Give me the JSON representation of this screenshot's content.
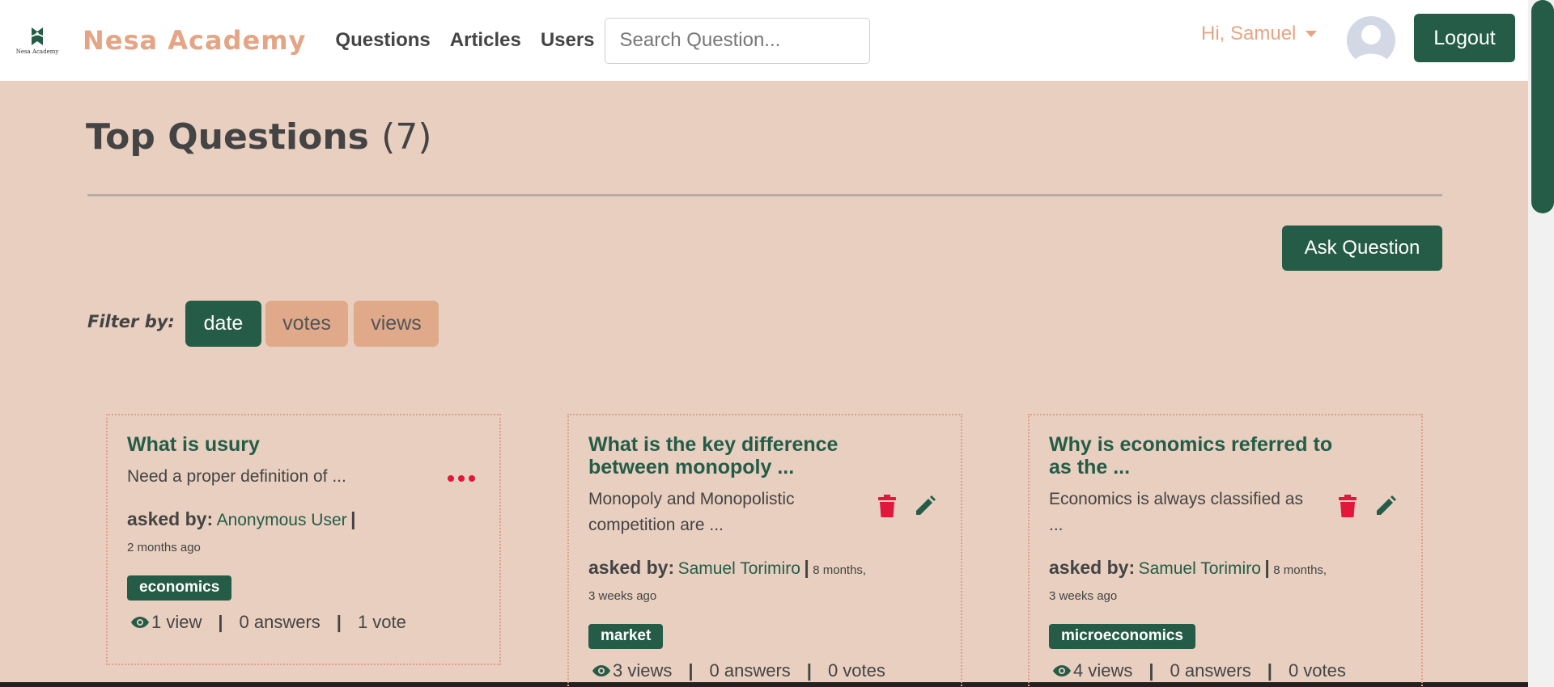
{
  "navbar": {
    "logo_text": "Nesa Academy",
    "brand": "Nesa Academy",
    "links": [
      "Questions",
      "Articles",
      "Users"
    ],
    "search_placeholder": "Search Question...",
    "greeting": "Hi, Samuel",
    "logout_label": "Logout"
  },
  "page": {
    "title": "Top Questions",
    "count": "(7)",
    "ask_label": "Ask Question",
    "filter_label": "Filter by:",
    "filters": [
      "date",
      "votes",
      "views"
    ],
    "active_filter": "date"
  },
  "questions": [
    {
      "title": "What is usury",
      "excerpt": "Need a proper definition of ...",
      "asked_by_label": "asked by:",
      "author": "Anonymous User",
      "time": "2 months ago",
      "tag": "economics",
      "views": "1 view",
      "answers": "0 answers",
      "votes": "1 vote"
    },
    {
      "title": "What is the key difference between monopoly ...",
      "excerpt": "Monopoly and Monopolistic competition are ...",
      "asked_by_label": "asked by:",
      "author": "Samuel Torimiro",
      "time_part1": "8 months,",
      "time_part2": "3 weeks ago",
      "tag": "market",
      "views": "3 views",
      "answers": "0 answers",
      "votes": "0 votes"
    },
    {
      "title": "Why is economics referred to as the ...",
      "excerpt": "Economics is always classified as ...",
      "asked_by_label": "asked by:",
      "author": "Samuel Torimiro",
      "time_part1": "8 months,",
      "time_part2": "3 weeks ago",
      "tag": "microeconomics",
      "views": "4 views",
      "answers": "0 answers",
      "votes": "0 votes"
    }
  ],
  "colors": {
    "primary": "#245c47",
    "accent": "#e5a585",
    "background": "#e8cfc0",
    "danger": "#e0183c"
  },
  "icons": {
    "delete": "trash-icon",
    "edit": "pencil-icon",
    "more": "more-dots-icon",
    "views": "eye-icon"
  }
}
